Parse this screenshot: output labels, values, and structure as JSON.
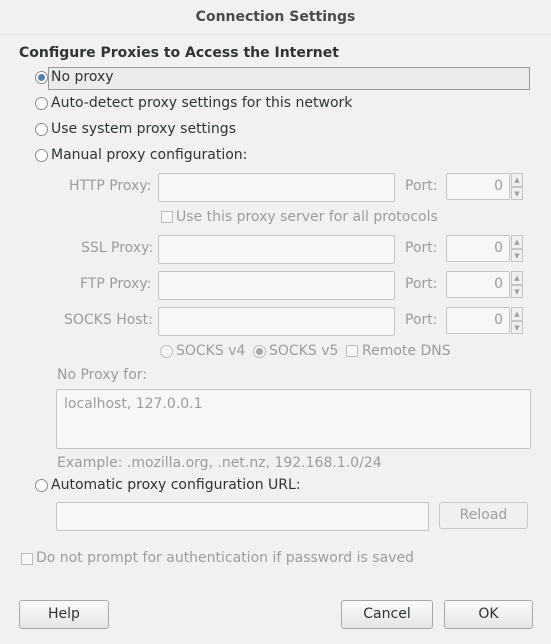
{
  "window": {
    "title": "Connection Settings"
  },
  "section": {
    "heading": "Configure Proxies to Access the Internet"
  },
  "options": {
    "no_proxy": "No proxy",
    "auto_detect": "Auto-detect proxy settings for this network",
    "system": "Use system proxy settings",
    "manual": "Manual proxy configuration:",
    "auto_url": "Automatic proxy configuration URL:"
  },
  "manual": {
    "http_label": "HTTP Proxy:",
    "ssl_label": "SSL Proxy:",
    "ftp_label": "FTP Proxy:",
    "socks_label": "SOCKS Host:",
    "port_label": "Port:",
    "http_port": "0",
    "ssl_port": "0",
    "ftp_port": "0",
    "socks_port": "0",
    "use_all_label": "Use this proxy server for all protocols",
    "socks_v4": "SOCKS v4",
    "socks_v5": "SOCKS v5",
    "remote_dns": "Remote DNS"
  },
  "no_proxy_for": {
    "label": "No Proxy for:",
    "value": "localhost, 127.0.0.1",
    "example": "Example: .mozilla.org, .net.nz, 192.168.1.0/24"
  },
  "auto_url": {
    "reload": "Reload"
  },
  "auth": {
    "label": "Do not prompt for authentication if password is saved"
  },
  "buttons": {
    "help": "Help",
    "cancel": "Cancel",
    "ok": "OK"
  },
  "icons": {
    "spin_up": "▲",
    "spin_down": "▼"
  }
}
